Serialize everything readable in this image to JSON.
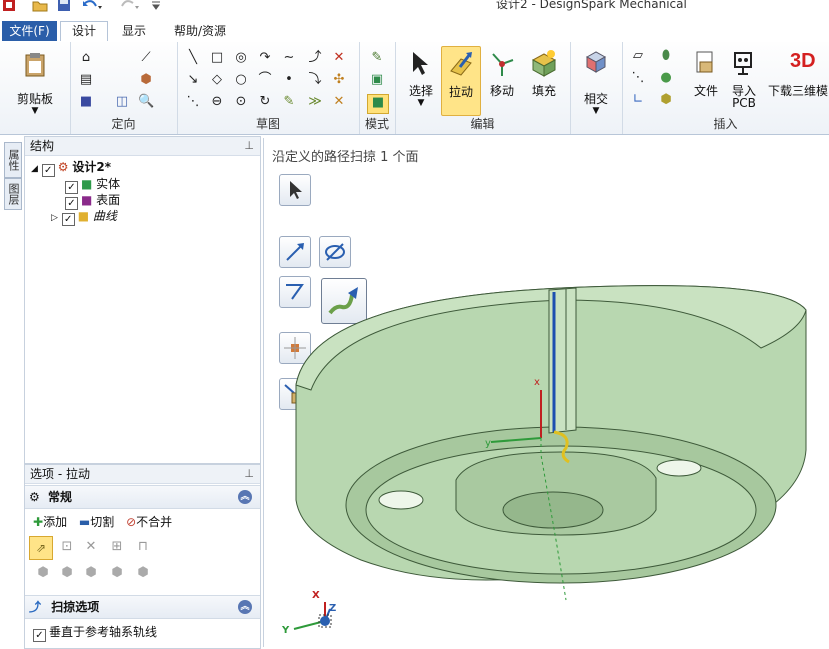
{
  "window": {
    "title": "设计2 - DesignSpark Mechanical"
  },
  "tabs": [
    {
      "label": "文件(F)"
    },
    {
      "label": "设计"
    },
    {
      "label": "显示"
    },
    {
      "label": "帮助/资源"
    }
  ],
  "ribbon": {
    "clipboard": {
      "button": "剪贴板"
    },
    "orient": {
      "label": "定向"
    },
    "sketch": {
      "label": "草图"
    },
    "mode": {
      "label": "模式"
    },
    "edit": {
      "label": "编辑",
      "select": "选择",
      "pull": "拉动",
      "move": "移动",
      "fill": "填充"
    },
    "intersect": {
      "label": "相交"
    },
    "insert": {
      "label": "插入",
      "file": "文件",
      "pcb_line1": "导入",
      "pcb_line2": "PCB",
      "download": "下载三维模"
    }
  },
  "side_tabs": [
    "属性",
    "图层"
  ],
  "structure": {
    "title": "结构",
    "root": "设计2*",
    "items": [
      "实体",
      "表面",
      "曲线"
    ]
  },
  "options": {
    "title": "选项 - 拉动",
    "section_general": "常规",
    "add": "添加",
    "cut": "切割",
    "nomerge": "不合并",
    "section_sweep": "扫掠选项",
    "perpendicular": "垂直于参考轴系轨线"
  },
  "viewport": {
    "status": "沿定义的路径扫掠 1 个面",
    "model_color": "#b8d7b0",
    "accent": "#2b5ea9",
    "triad": {
      "x": "X",
      "y": "Y",
      "z": "Z"
    }
  }
}
